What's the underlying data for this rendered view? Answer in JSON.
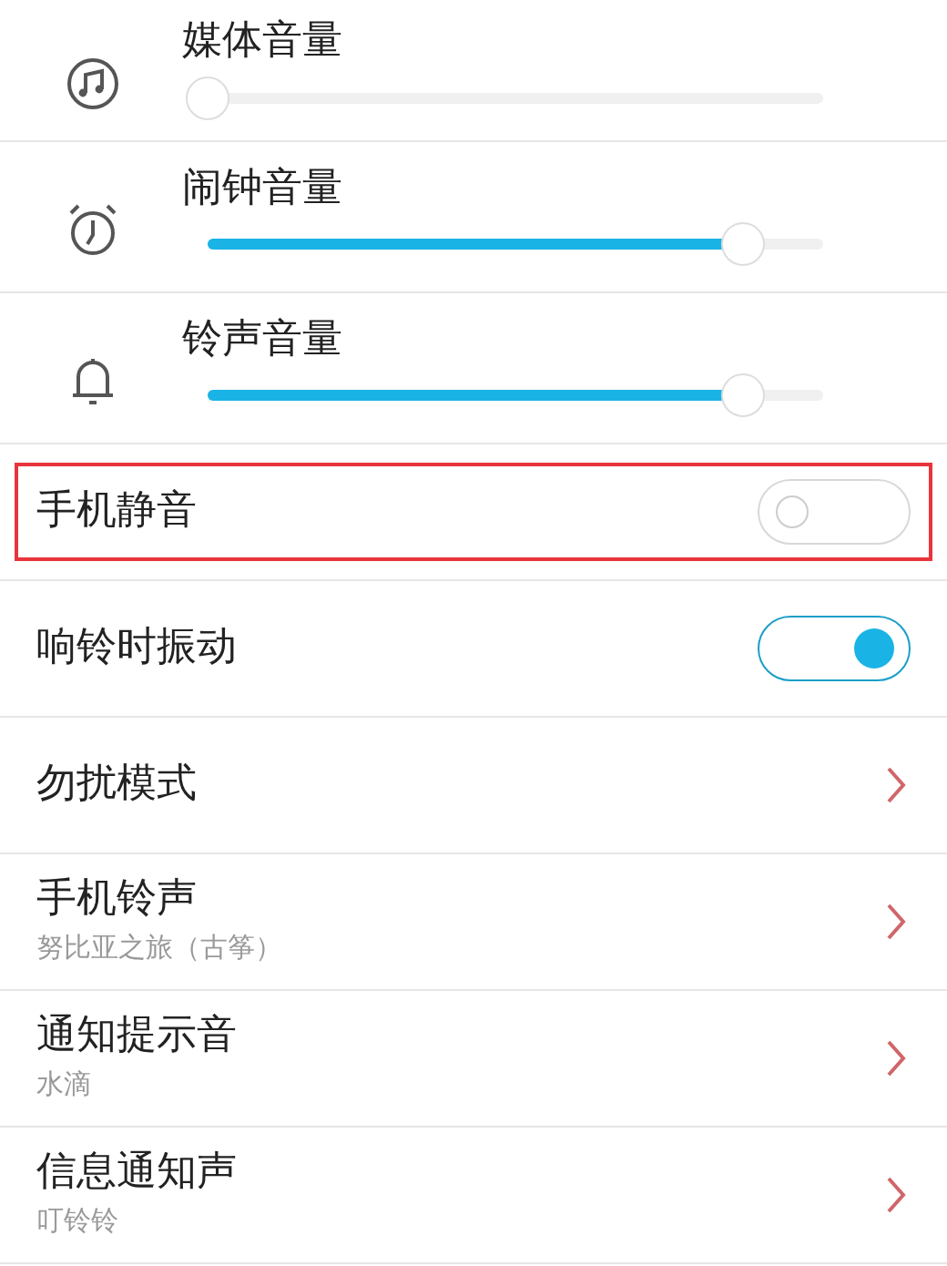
{
  "volumes": [
    {
      "label": "媒体音量",
      "level": 0.0
    },
    {
      "label": "闹钟音量",
      "level": 0.87
    },
    {
      "label": "铃声音量",
      "level": 0.87
    }
  ],
  "items": [
    {
      "kind": "toggle",
      "label": "手机静音",
      "on": false,
      "highlighted": true
    },
    {
      "kind": "toggle",
      "label": "响铃时振动",
      "on": true,
      "highlighted": false
    },
    {
      "kind": "link",
      "label": "勿扰模式"
    },
    {
      "kind": "link",
      "label": "手机铃声",
      "value": "努比亚之旅（古筝）"
    },
    {
      "kind": "link",
      "label": "通知提示音",
      "value": "水滴"
    },
    {
      "kind": "link",
      "label": "信息通知声",
      "value": "叮铃铃"
    }
  ]
}
